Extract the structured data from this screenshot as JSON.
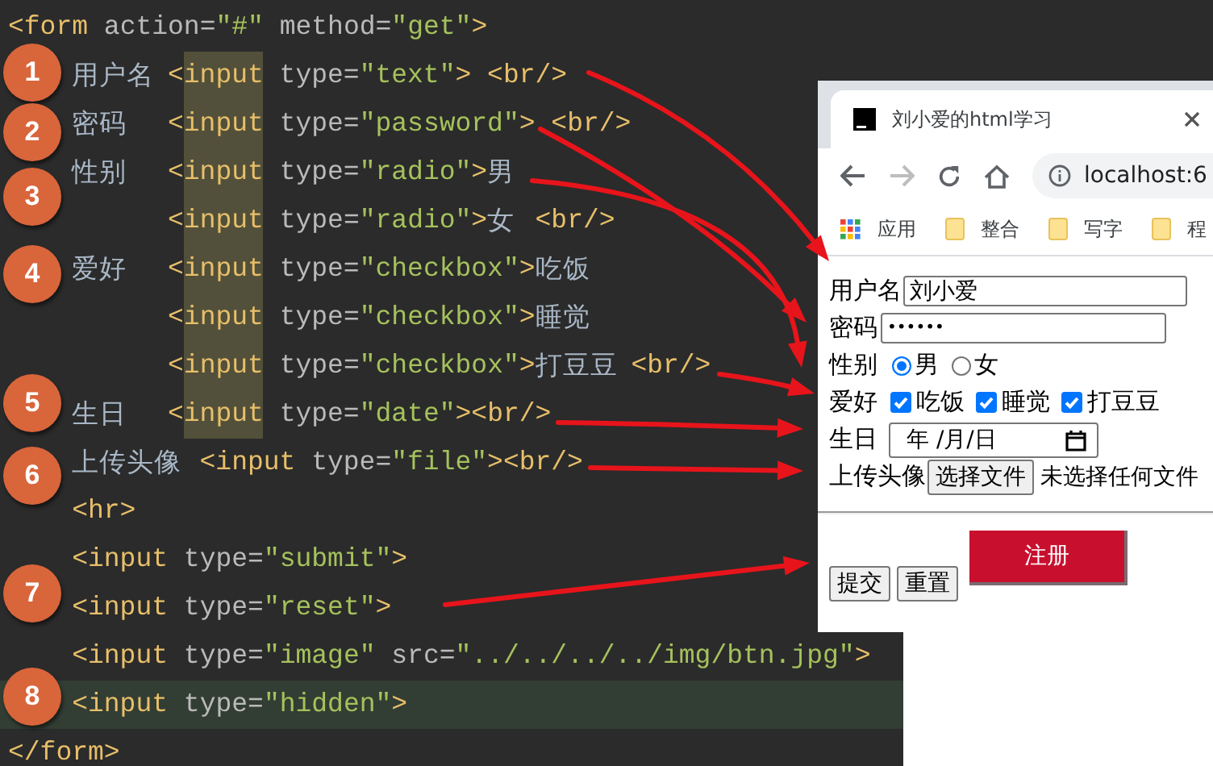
{
  "editor": {
    "lines": [
      {
        "kind": "root",
        "current": false,
        "segments": [
          {
            "kind": "tag",
            "text": "<form"
          },
          {
            "kind": "attr",
            "text": " action="
          },
          {
            "kind": "str",
            "text": "\"#\""
          },
          {
            "kind": "attr",
            "text": " method="
          },
          {
            "kind": "str",
            "text": "\"get\""
          },
          {
            "kind": "tag",
            "text": ">"
          }
        ]
      },
      {
        "kind": "child",
        "current": false,
        "segments": [
          {
            "kind": "text",
            "text": "用户名"
          },
          {
            "kind": "tag",
            "text": "<"
          },
          {
            "kind": "match",
            "text": "input"
          },
          {
            "kind": "attr",
            "text": " type="
          },
          {
            "kind": "str",
            "text": "\"text\""
          },
          {
            "kind": "tag",
            "text": "> <br/>"
          }
        ]
      },
      {
        "kind": "child",
        "current": false,
        "segments": [
          {
            "kind": "text",
            "text": "密码"
          },
          {
            "kind": "tag",
            "text": "  <"
          },
          {
            "kind": "match",
            "text": "input"
          },
          {
            "kind": "attr",
            "text": " type="
          },
          {
            "kind": "str",
            "text": "\"password\""
          },
          {
            "kind": "tag",
            "text": "> <br/>"
          }
        ]
      },
      {
        "kind": "child",
        "current": false,
        "segments": [
          {
            "kind": "text",
            "text": "性别"
          },
          {
            "kind": "tag",
            "text": "  <"
          },
          {
            "kind": "match",
            "text": "input"
          },
          {
            "kind": "attr",
            "text": " type="
          },
          {
            "kind": "str",
            "text": "\"radio\""
          },
          {
            "kind": "tag",
            "text": ">"
          },
          {
            "kind": "text",
            "text": "男"
          }
        ]
      },
      {
        "kind": "continuation",
        "current": false,
        "segments": [
          {
            "kind": "tag",
            "text": "<"
          },
          {
            "kind": "match",
            "text": "input"
          },
          {
            "kind": "attr",
            "text": " type="
          },
          {
            "kind": "str",
            "text": "\"radio\""
          },
          {
            "kind": "tag",
            "text": ">"
          },
          {
            "kind": "text",
            "text": "女"
          },
          {
            "kind": "tag",
            "text": " <br/>"
          }
        ]
      },
      {
        "kind": "child",
        "current": false,
        "segments": [
          {
            "kind": "text",
            "text": "爱好"
          },
          {
            "kind": "tag",
            "text": "  <"
          },
          {
            "kind": "match",
            "text": "input"
          },
          {
            "kind": "attr",
            "text": " type="
          },
          {
            "kind": "str",
            "text": "\"checkbox\""
          },
          {
            "kind": "tag",
            "text": ">"
          },
          {
            "kind": "text",
            "text": "吃饭"
          }
        ]
      },
      {
        "kind": "continuation",
        "current": false,
        "segments": [
          {
            "kind": "tag",
            "text": "<"
          },
          {
            "kind": "match",
            "text": "input"
          },
          {
            "kind": "attr",
            "text": " type="
          },
          {
            "kind": "str",
            "text": "\"checkbox\""
          },
          {
            "kind": "tag",
            "text": ">"
          },
          {
            "kind": "text",
            "text": "睡觉"
          }
        ]
      },
      {
        "kind": "continuation",
        "current": false,
        "segments": [
          {
            "kind": "tag",
            "text": "<"
          },
          {
            "kind": "match",
            "text": "input"
          },
          {
            "kind": "attr",
            "text": " type="
          },
          {
            "kind": "str",
            "text": "\"checkbox\""
          },
          {
            "kind": "tag",
            "text": ">"
          },
          {
            "kind": "text",
            "text": "打豆豆"
          },
          {
            "kind": "tag",
            "text": "<br/>"
          }
        ]
      },
      {
        "kind": "child",
        "current": false,
        "segments": [
          {
            "kind": "text",
            "text": "生日"
          },
          {
            "kind": "tag",
            "text": "  <"
          },
          {
            "kind": "match",
            "text": "input"
          },
          {
            "kind": "attr",
            "text": " type="
          },
          {
            "kind": "str",
            "text": "\"date\""
          },
          {
            "kind": "tag",
            "text": "><br/>"
          }
        ]
      },
      {
        "kind": "child",
        "current": false,
        "segments": [
          {
            "kind": "text",
            "text": "上传头像"
          },
          {
            "kind": "tag",
            "text": "<input"
          },
          {
            "kind": "attr",
            "text": " type="
          },
          {
            "kind": "str",
            "text": "\"file\""
          },
          {
            "kind": "tag",
            "text": "><br/>"
          }
        ]
      },
      {
        "kind": "child",
        "current": false,
        "segments": [
          {
            "kind": "tag",
            "text": "<hr>"
          }
        ]
      },
      {
        "kind": "child",
        "current": false,
        "segments": [
          {
            "kind": "tag",
            "text": "<input"
          },
          {
            "kind": "attr",
            "text": " type="
          },
          {
            "kind": "str",
            "text": "\"submit\""
          },
          {
            "kind": "tag",
            "text": ">"
          }
        ]
      },
      {
        "kind": "child",
        "current": false,
        "segments": [
          {
            "kind": "tag",
            "text": "<input"
          },
          {
            "kind": "attr",
            "text": " type="
          },
          {
            "kind": "str",
            "text": "\"reset\""
          },
          {
            "kind": "tag",
            "text": ">"
          }
        ]
      },
      {
        "kind": "child",
        "current": false,
        "segments": [
          {
            "kind": "tag",
            "text": "<input"
          },
          {
            "kind": "attr",
            "text": " type="
          },
          {
            "kind": "str",
            "text": "\"image\""
          },
          {
            "kind": "attr",
            "text": " src="
          },
          {
            "kind": "str",
            "text": "\"../../../../img/btn.jpg\""
          },
          {
            "kind": "tag",
            "text": ">"
          }
        ]
      },
      {
        "kind": "child",
        "current": true,
        "segments": [
          {
            "kind": "tag",
            "text": "<input"
          },
          {
            "kind": "attr",
            "text": " type="
          },
          {
            "kind": "str",
            "text": "\"hidden\""
          },
          {
            "kind": "tag",
            "text": ">"
          }
        ]
      },
      {
        "kind": "root",
        "current": false,
        "segments": [
          {
            "kind": "tag",
            "text": "</form>"
          }
        ]
      }
    ]
  },
  "markers": [
    "1",
    "2",
    "3",
    "4",
    "5",
    "6",
    "7",
    "8"
  ],
  "browser": {
    "tab_title": "刘小爱的html学习",
    "address": "localhost:6",
    "bookmarks": [
      {
        "kind": "apps",
        "label": "应用"
      },
      {
        "kind": "folder",
        "label": "整合"
      },
      {
        "kind": "folder",
        "label": "写字"
      },
      {
        "kind": "folder",
        "label": "程"
      }
    ],
    "form": {
      "fields": [
        {
          "kind": "text",
          "label": "用户名",
          "value": "刘小爱"
        },
        {
          "kind": "password",
          "label": "密码",
          "value": "••••••"
        },
        {
          "kind": "radio",
          "label": "性别",
          "options": [
            {
              "label": "男",
              "selected": true
            },
            {
              "label": "女",
              "selected": false
            }
          ]
        },
        {
          "kind": "checkbox",
          "label": "爱好",
          "options": [
            {
              "label": "吃饭",
              "checked": true
            },
            {
              "label": "睡觉",
              "checked": true
            },
            {
              "label": "打豆豆",
              "checked": true
            }
          ]
        },
        {
          "kind": "date",
          "label": "生日",
          "value": "年 /月/日"
        },
        {
          "kind": "file",
          "label": "上传头像",
          "button": "选择文件",
          "status": "未选择任何文件"
        }
      ],
      "buttons": [
        {
          "kind": "submit",
          "label": "提交"
        },
        {
          "kind": "reset",
          "label": "重置"
        },
        {
          "kind": "image",
          "label": "注册"
        }
      ]
    }
  }
}
